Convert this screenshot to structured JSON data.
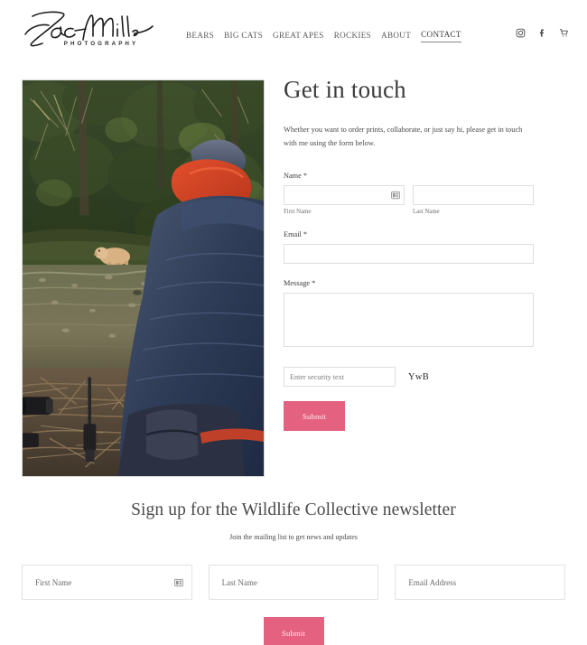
{
  "header": {
    "logo": {
      "signature": "Zac Mills",
      "subtitle": "PHOTOGRAPHY"
    },
    "nav": [
      {
        "label": "BEARS",
        "active": false
      },
      {
        "label": "BIG CATS",
        "active": false
      },
      {
        "label": "GREAT APES",
        "active": false
      },
      {
        "label": "ROCKIES",
        "active": false
      },
      {
        "label": "ABOUT",
        "active": false
      },
      {
        "label": "CONTACT",
        "active": true
      }
    ],
    "social": [
      {
        "icon": "instagram-icon"
      },
      {
        "icon": "facebook-icon"
      },
      {
        "icon": "shopping-cart-icon"
      }
    ]
  },
  "main": {
    "photo": {
      "alt": "Photographer in blue and red jacket watching a spirit bear across a forest stream, camera and tripod on the forest floor"
    },
    "title": "Get in touch",
    "intro": "Whether you want to order prints, collaborate, or just say hi, please get in touch with me using the form below.",
    "form": {
      "name": {
        "label": "Name *",
        "first": {
          "value": "",
          "placeholder": "",
          "sub_label": "First Name"
        },
        "last": {
          "value": "",
          "placeholder": "",
          "sub_label": "Last Name"
        }
      },
      "email": {
        "label": "Email *",
        "value": "",
        "placeholder": ""
      },
      "message": {
        "label": "Message *",
        "value": "",
        "placeholder": ""
      },
      "captcha": {
        "placeholder": "Enter security text",
        "value": "",
        "text": "YwB"
      },
      "submit_label": "Submit"
    }
  },
  "newsletter": {
    "title": "Sign up for the Wildlife Collective newsletter",
    "subtitle": "Join the mailing list to get news and updates",
    "fields": [
      {
        "placeholder": "First Name",
        "value": "",
        "name": "first-name"
      },
      {
        "placeholder": "Last Name",
        "value": "",
        "name": "last-name"
      },
      {
        "placeholder": "Email Address",
        "value": "",
        "name": "email-address"
      }
    ],
    "submit_label": "Submit"
  },
  "colors": {
    "accent_pink": "#e4627f",
    "text_dark": "#3c3c3c",
    "border_grey": "#dedede"
  }
}
